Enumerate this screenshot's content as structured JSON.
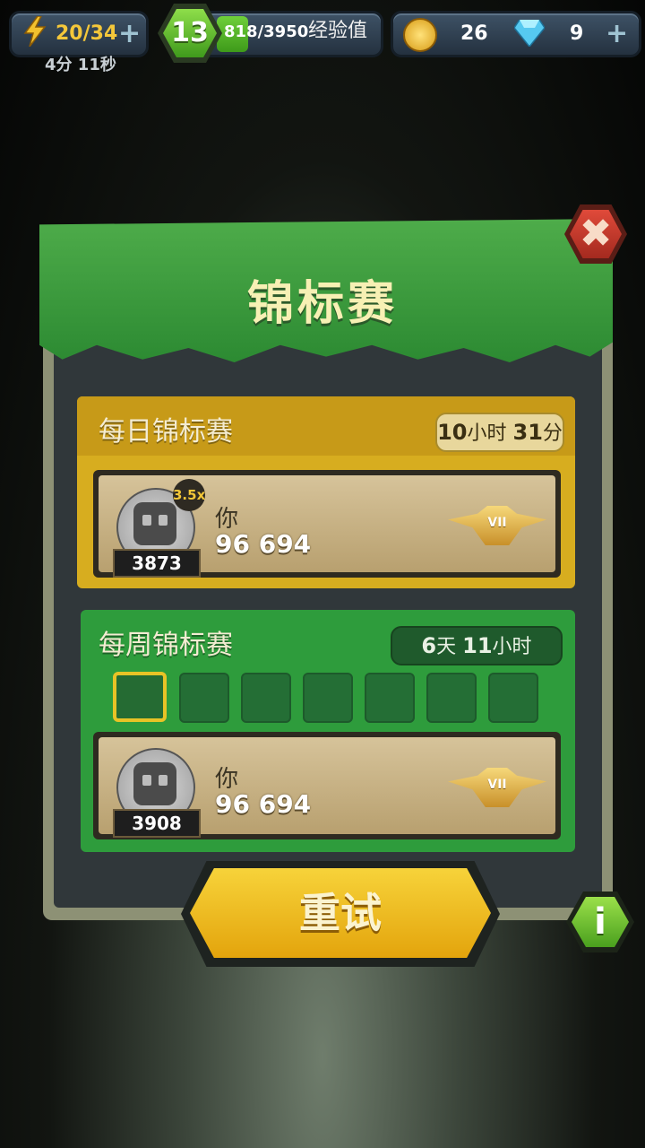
{
  "topbar": {
    "energy": "20/34",
    "energy_timer": "4分 11秒",
    "level": "13",
    "xp_value": "818/3950",
    "xp_label": "经验值",
    "xp_progress": 0.207,
    "coins": "26",
    "gems": "9"
  },
  "dialog": {
    "title": "锦标赛",
    "close_glyph": "✖"
  },
  "daily": {
    "label": "每日锦标赛",
    "timer_a": "10",
    "timer_a_unit": "小时",
    "timer_b": "31",
    "timer_b_unit": "分",
    "player": {
      "rank": "3873",
      "multiplier": "3.5x",
      "name": "你",
      "score": "96 694",
      "league": "VII"
    }
  },
  "weekly": {
    "label": "每周锦标赛",
    "timer_a": "6",
    "timer_a_unit": "天",
    "timer_b": "11",
    "timer_b_unit": "小时",
    "slots_filled": 1,
    "slots_total": 7,
    "player": {
      "rank": "3908",
      "name": "你",
      "score": "96 694",
      "league": "VII"
    }
  },
  "buttons": {
    "retry": "重试",
    "info": "i"
  },
  "icons": {
    "energy": "lightning-icon",
    "coin": "coin-icon",
    "gem": "diamond-icon"
  },
  "colors": {
    "daily_section": "#d7ad1f",
    "weekly_section": "#2e9c3c",
    "banner": "#3f9c40",
    "retry_button": "#f0bc22"
  }
}
